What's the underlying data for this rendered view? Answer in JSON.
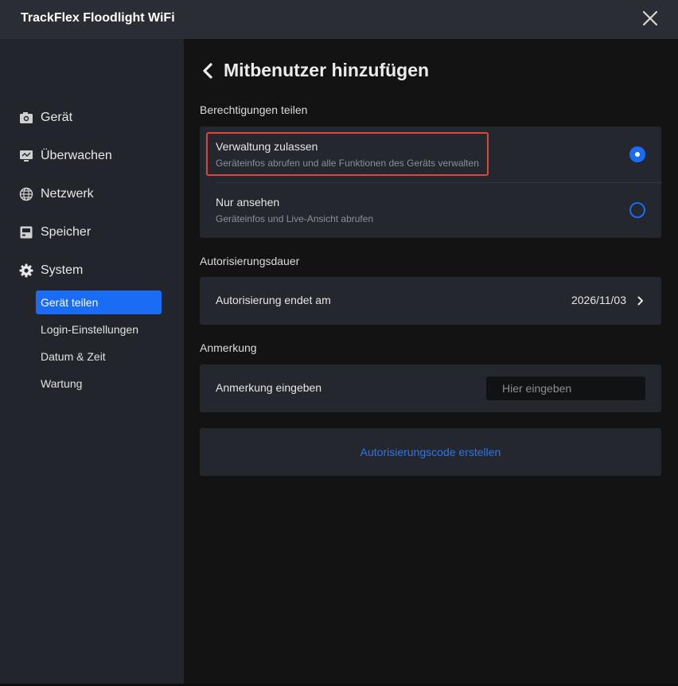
{
  "window": {
    "title": "TrackFlex Floodlight WiFi"
  },
  "sidebar": {
    "items": [
      {
        "label": "Gerät",
        "icon": "camera-icon"
      },
      {
        "label": "Überwachen",
        "icon": "monitor-icon"
      },
      {
        "label": "Netzwerk",
        "icon": "globe-icon"
      },
      {
        "label": "Speicher",
        "icon": "storage-icon"
      },
      {
        "label": "System",
        "icon": "gear-icon"
      }
    ],
    "subitems": [
      {
        "label": "Gerät teilen",
        "active": true
      },
      {
        "label": "Login-Einstellungen",
        "active": false
      },
      {
        "label": "Datum & Zeit",
        "active": false
      },
      {
        "label": "Wartung",
        "active": false
      }
    ]
  },
  "main": {
    "title": "Mitbenutzer hinzufügen",
    "permissions": {
      "label": "Berechtigungen teilen",
      "options": [
        {
          "title": "Verwaltung zulassen",
          "description": "Geräteinfos abrufen und alle Funktionen des Geräts verwalten",
          "selected": true
        },
        {
          "title": "Nur ansehen",
          "description": "Geräteinfos und Live-Ansicht abrufen",
          "selected": false
        }
      ]
    },
    "duration": {
      "label": "Autorisierungsdauer",
      "row_label": "Autorisierung endet am",
      "value": "2026/11/03"
    },
    "note": {
      "label": "Anmerkung",
      "row_label": "Anmerkung eingeben",
      "placeholder": "Hier eingeben",
      "value": ""
    },
    "action_label": "Autorisierungscode erstellen"
  },
  "colors": {
    "accent": "#1a6cf5",
    "highlight_border": "#e0453c",
    "link": "#2a74ee"
  }
}
